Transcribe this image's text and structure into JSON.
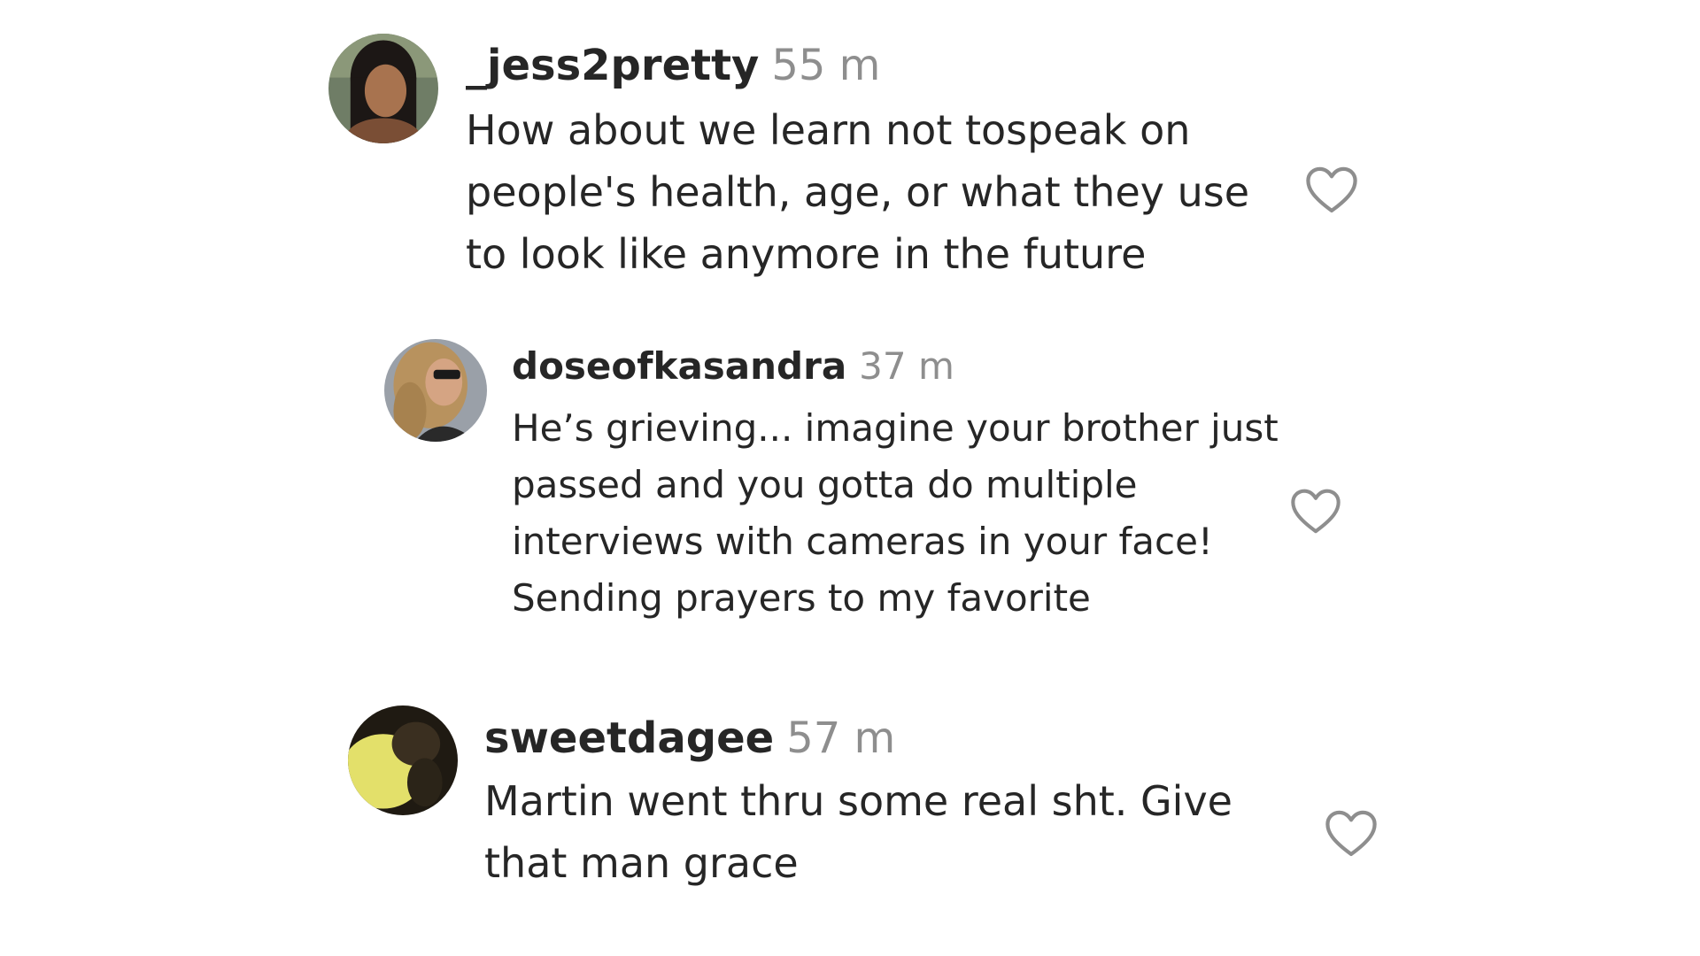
{
  "comments": [
    {
      "username": "_jess2pretty",
      "time": "55 m",
      "text": "How about we learn not tospeak on people's health, age, or what they use to look like anymore in the future",
      "avatar_icon": "avatar-photo",
      "like_icon": "heart-outline-icon"
    },
    {
      "username": "doseofkasandra",
      "time": "37 m",
      "text": "He’s grieving... imagine your brother just passed and you gotta do multiple interviews with cameras in your face! Sending prayers to my favorite",
      "avatar_icon": "avatar-photo",
      "like_icon": "heart-outline-icon"
    },
    {
      "username": "sweetdagee",
      "time": "57 m",
      "text": "Martin went thru some real sht. Give that man grace",
      "avatar_icon": "avatar-photo",
      "like_icon": "heart-outline-icon"
    }
  ],
  "colors": {
    "username": "#262626",
    "timestamp": "#8e8e8e",
    "text": "#262626",
    "heart_outline": "#8e8e8e",
    "background": "#ffffff"
  }
}
